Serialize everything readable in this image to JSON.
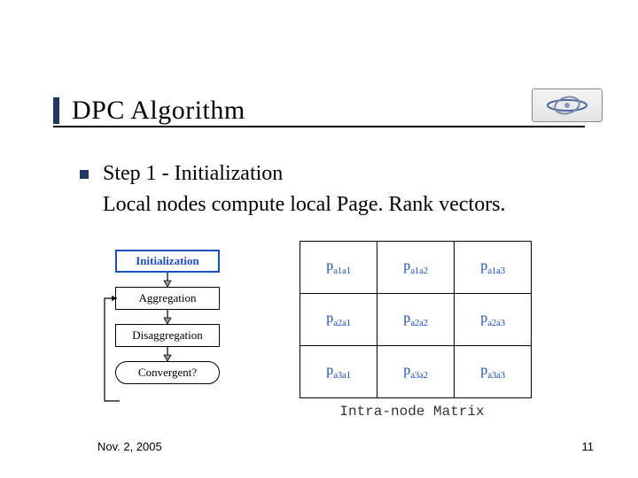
{
  "title": "DPC Algorithm",
  "bullet": {
    "line1": "Step 1 - Initialization",
    "line2": "Local nodes compute local Page. Rank vectors."
  },
  "flow": {
    "steps": [
      "Initialization",
      "Aggregation",
      "Disaggregation",
      "Convergent?"
    ]
  },
  "matrix": {
    "caption": "Intra-node Matrix",
    "rows": [
      [
        {
          "p": "p",
          "sub": "a1a1"
        },
        {
          "p": "p",
          "sub": "a1a2"
        },
        {
          "p": "p",
          "sub": "a1a3"
        }
      ],
      [
        {
          "p": "p",
          "sub": "a2a1"
        },
        {
          "p": "p",
          "sub": "a2a2"
        },
        {
          "p": "p",
          "sub": "a2a3"
        }
      ],
      [
        {
          "p": "p",
          "sub": "a3a1"
        },
        {
          "p": "p",
          "sub": "a3a2"
        },
        {
          "p": "p",
          "sub": "a3a3"
        }
      ]
    ]
  },
  "footer": {
    "date": "Nov. 2, 2005",
    "page": "11"
  },
  "colors": {
    "accent_blue": "#1a4fc2",
    "dark_navy": "#203864"
  }
}
